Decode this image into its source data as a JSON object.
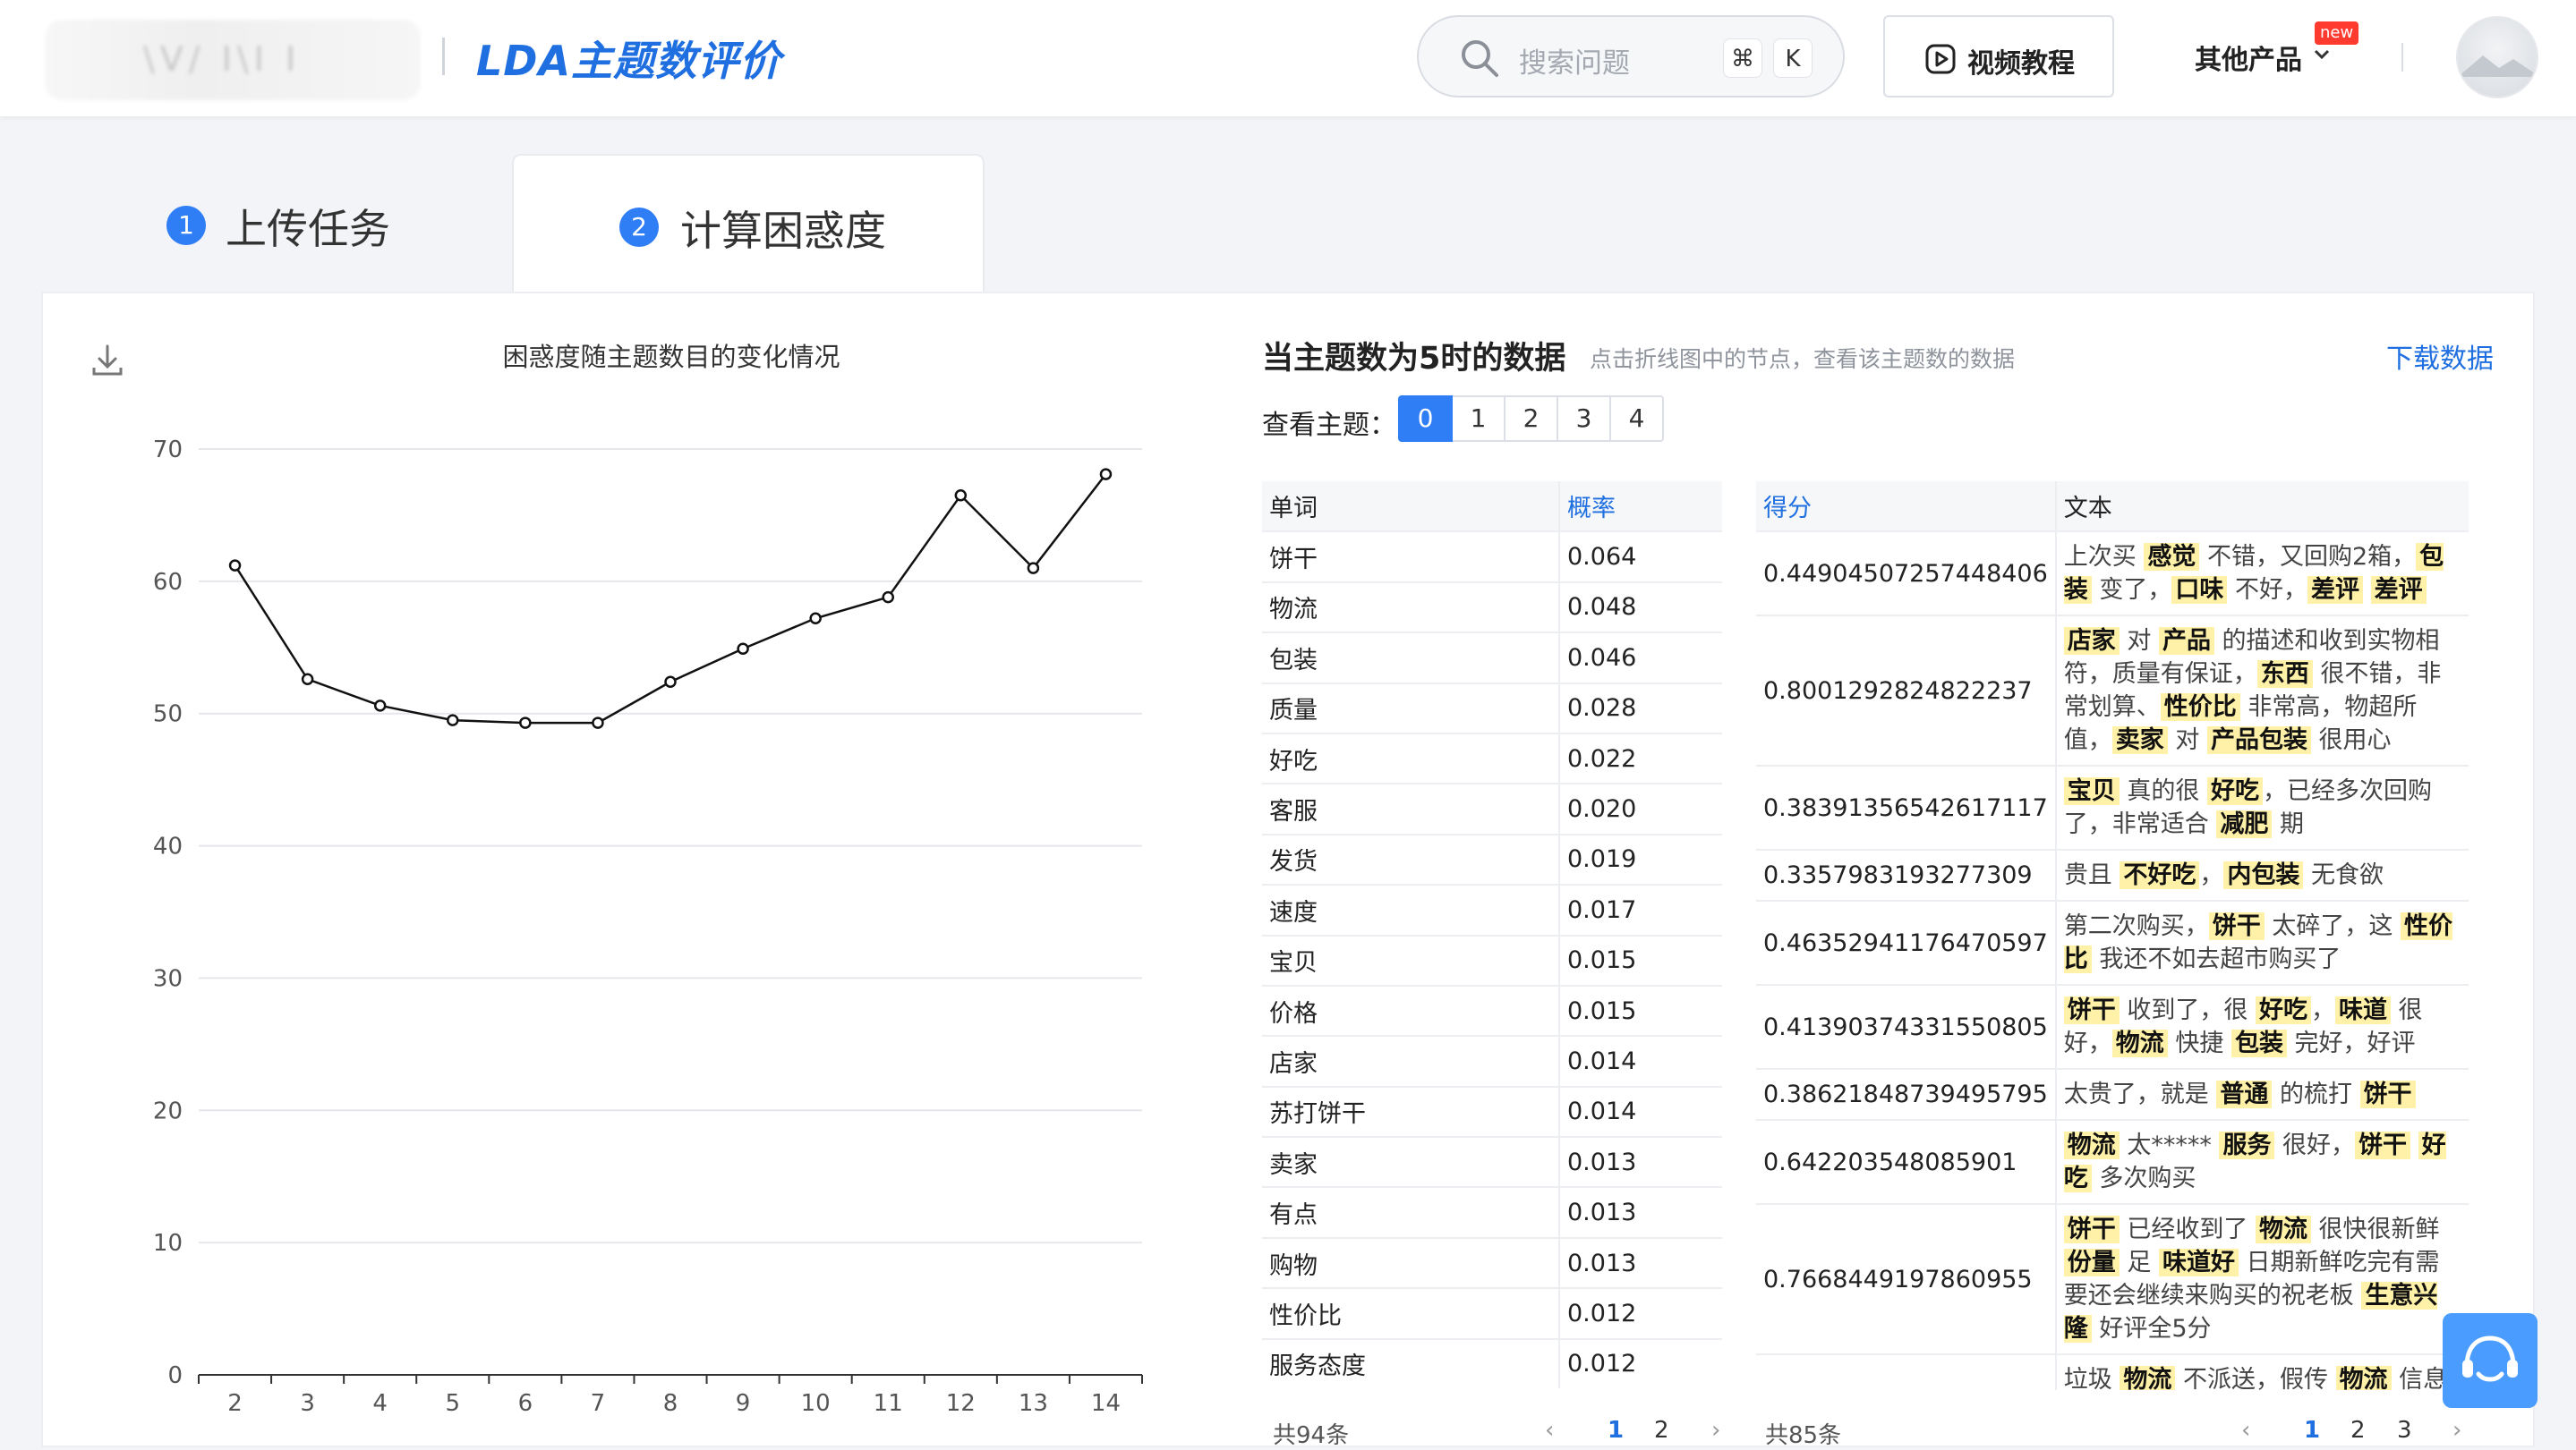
{
  "header": {
    "app_title": "LDA主题数评价",
    "search_placeholder": "搜索问题",
    "search_kbd": [
      "⌘",
      "K"
    ],
    "video_button": "视频教程",
    "other_products": "其他产品",
    "new_badge": "new"
  },
  "tabs": [
    {
      "num": "1",
      "label": "上传任务"
    },
    {
      "num": "2",
      "label": "计算困惑度"
    }
  ],
  "chart_data": {
    "type": "line",
    "title": "困惑度随主题数目的变化情况",
    "x": [
      2,
      3,
      4,
      5,
      6,
      7,
      8,
      9,
      10,
      11,
      12,
      13,
      14
    ],
    "y": [
      61.2,
      52.6,
      50.6,
      49.5,
      49.3,
      49.3,
      52.4,
      54.9,
      57.2,
      58.8,
      66.5,
      61.0,
      68.1
    ],
    "xlabel": "",
    "ylabel": "",
    "ylim": [
      0,
      70
    ],
    "yticks": [
      0,
      10,
      20,
      30,
      40,
      50,
      60,
      70
    ],
    "grid": true,
    "legend": "none"
  },
  "data_panel": {
    "title": "当主题数为5时的数据",
    "hint": "点击折线图中的节点，查看该主题数的数据",
    "download": "下载数据",
    "topic_label": "查看主题：",
    "topics": [
      "0",
      "1",
      "2",
      "3",
      "4"
    ],
    "active_topic": "0"
  },
  "word_table": {
    "headers": [
      "单词",
      "概率"
    ],
    "rows": [
      [
        "饼干",
        "0.064"
      ],
      [
        "物流",
        "0.048"
      ],
      [
        "包装",
        "0.046"
      ],
      [
        "质量",
        "0.028"
      ],
      [
        "好吃",
        "0.022"
      ],
      [
        "客服",
        "0.020"
      ],
      [
        "发货",
        "0.019"
      ],
      [
        "速度",
        "0.017"
      ],
      [
        "宝贝",
        "0.015"
      ],
      [
        "价格",
        "0.015"
      ],
      [
        "店家",
        "0.014"
      ],
      [
        "苏打饼干",
        "0.014"
      ],
      [
        "卖家",
        "0.013"
      ],
      [
        "有点",
        "0.013"
      ],
      [
        "购物",
        "0.013"
      ],
      [
        "性价比",
        "0.012"
      ],
      [
        "服务态度",
        "0.012"
      ]
    ],
    "total": "共94条",
    "pages": [
      "1",
      "2"
    ],
    "active_page": "1"
  },
  "doc_table": {
    "headers": [
      "得分",
      "文本"
    ],
    "rows": [
      {
        "score": "0.44904507257448406",
        "text": [
          [
            "上次买 ",
            0
          ],
          [
            "感觉",
            1
          ],
          [
            " 不错，又回购2箱，",
            0
          ],
          [
            "包装",
            1
          ],
          [
            " 变了，",
            0
          ],
          [
            "口味",
            1
          ],
          [
            " 不好，",
            0
          ],
          [
            "差评",
            1
          ],
          [
            " ",
            0
          ],
          [
            "差评",
            1
          ]
        ]
      },
      {
        "score": "0.8001292824822237",
        "text": [
          [
            "店家",
            1
          ],
          [
            " 对 ",
            0
          ],
          [
            "产品",
            1
          ],
          [
            " 的描述和收到实物相符，质量有保证，",
            0
          ],
          [
            "东西",
            1
          ],
          [
            " 很不错，非常划算、",
            0
          ],
          [
            "性价比",
            1
          ],
          [
            " 非常高，物超所值，",
            0
          ],
          [
            "卖家",
            1
          ],
          [
            " 对 ",
            0
          ],
          [
            "产品包装",
            1
          ],
          [
            " 很用心",
            0
          ]
        ]
      },
      {
        "score": "0.38391356542617117",
        "text": [
          [
            "宝贝",
            1
          ],
          [
            " 真的很 ",
            0
          ],
          [
            "好吃",
            1
          ],
          [
            "，已经多次回购了，非常适合 ",
            0
          ],
          [
            "减肥",
            1
          ],
          [
            " 期",
            0
          ]
        ]
      },
      {
        "score": "0.3357983193277309",
        "text": [
          [
            "贵且 ",
            0
          ],
          [
            "不好吃",
            1
          ],
          [
            "，",
            0
          ],
          [
            "内包装",
            1
          ],
          [
            " 无食欲",
            0
          ]
        ]
      },
      {
        "score": "0.46352941176470597",
        "text": [
          [
            "第二次购买，",
            0
          ],
          [
            "饼干",
            1
          ],
          [
            " 太碎了，这 ",
            0
          ],
          [
            "性价比",
            1
          ],
          [
            " 我还不如去超市购买了",
            0
          ]
        ]
      },
      {
        "score": "0.41390374331550805",
        "text": [
          [
            "饼干",
            1
          ],
          [
            " 收到了，很 ",
            0
          ],
          [
            "好吃",
            1
          ],
          [
            "，",
            0
          ],
          [
            "味道",
            1
          ],
          [
            " 很好，",
            0
          ],
          [
            "物流",
            1
          ],
          [
            " 快捷 ",
            0
          ],
          [
            "包装",
            1
          ],
          [
            " 完好，好评",
            0
          ]
        ]
      },
      {
        "score": "0.38621848739495795",
        "text": [
          [
            "太贵了，就是 ",
            0
          ],
          [
            "普通",
            1
          ],
          [
            " 的梳打 ",
            0
          ],
          [
            "饼干",
            1
          ]
        ]
      },
      {
        "score": "0.642203548085901",
        "text": [
          [
            "物流",
            1
          ],
          [
            " 太***** ",
            0
          ],
          [
            "服务",
            1
          ],
          [
            " 很好，",
            0
          ],
          [
            "饼干",
            1
          ],
          [
            " ",
            0
          ],
          [
            "好吃",
            1
          ],
          [
            " 多次购买",
            0
          ]
        ]
      },
      {
        "score": "0.7668449197860955",
        "text": [
          [
            "饼干",
            1
          ],
          [
            " 已经收到了 ",
            0
          ],
          [
            "物流",
            1
          ],
          [
            " 很快很新鲜 ",
            0
          ],
          [
            "份量",
            1
          ],
          [
            " 足 ",
            0
          ],
          [
            "味道好",
            1
          ],
          [
            " 日期新鲜吃完有需要还会继续来购买的祝老板 ",
            0
          ],
          [
            "生意兴隆",
            1
          ],
          [
            " 好评全5分",
            0
          ]
        ]
      },
      {
        "score": "",
        "text": [
          [
            "垃圾 ",
            0
          ],
          [
            "物流",
            1
          ],
          [
            " 不派送，假传 ",
            0
          ],
          [
            "物流",
            1
          ],
          [
            " 信息",
            0
          ]
        ]
      }
    ],
    "total": "共85条",
    "pages": [
      "1",
      "2",
      "3"
    ],
    "active_page": "1"
  },
  "colors": {
    "accent": "#2f7ef5",
    "link": "#1f6fe0",
    "highlight": "#fff1a8",
    "line": "#111111"
  }
}
